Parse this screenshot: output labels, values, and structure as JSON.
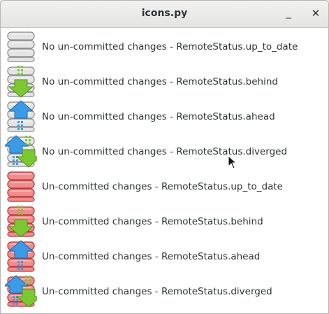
{
  "window": {
    "title": "icons.py",
    "minimize_symbol": "_",
    "close_symbol": "✕"
  },
  "colors": {
    "db_clean_fill": "#e4e4e4",
    "db_clean_stroke": "#8a8a8a",
    "db_dirty_fill": "#f28b8b",
    "db_dirty_stroke": "#b53a3a",
    "arrow_behind": "#7cc832",
    "arrow_ahead": "#3c9be6"
  },
  "items": [
    {
      "label": "No un-committed changes - RemoteStatus.up_to_date",
      "icon": "database-clean-icon",
      "dirty": false,
      "status": "up_to_date"
    },
    {
      "label": "No un-committed changes - RemoteStatus.behind",
      "icon": "database-clean-behind-icon",
      "dirty": false,
      "status": "behind"
    },
    {
      "label": "No un-committed changes - RemoteStatus.ahead",
      "icon": "database-clean-ahead-icon",
      "dirty": false,
      "status": "ahead"
    },
    {
      "label": "No un-committed changes - RemoteStatus.diverged",
      "icon": "database-clean-diverged-icon",
      "dirty": false,
      "status": "diverged"
    },
    {
      "label": "Un-committed changes - RemoteStatus.up_to_date",
      "icon": "database-dirty-icon",
      "dirty": true,
      "status": "up_to_date"
    },
    {
      "label": "Un-committed changes - RemoteStatus.behind",
      "icon": "database-dirty-behind-icon",
      "dirty": true,
      "status": "behind"
    },
    {
      "label": "Un-committed changes - RemoteStatus.ahead",
      "icon": "database-dirty-ahead-icon",
      "dirty": true,
      "status": "ahead"
    },
    {
      "label": "Un-committed changes - RemoteStatus.diverged",
      "icon": "database-dirty-diverged-icon",
      "dirty": true,
      "status": "diverged"
    }
  ]
}
